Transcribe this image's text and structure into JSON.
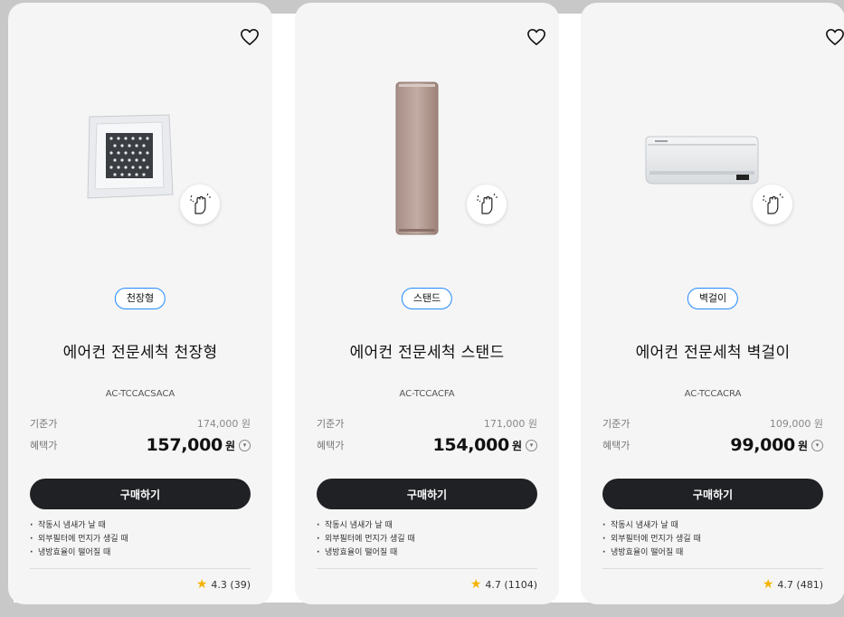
{
  "products": [
    {
      "tag": "천장형",
      "title": "에어컨 전문세척 천장형",
      "model": "AC-TCCACSACA",
      "base_label": "기준가",
      "base_price": "174,000 원",
      "benefit_label": "혜택가",
      "benefit_price": "157,000",
      "currency": "원",
      "buy_label": "구매하기",
      "notes": [
        "작동시 냄새가 날 때",
        "외부필터에 먼지가 생길 때",
        "냉방효율이 떨어질 때"
      ],
      "rating": "4.3 (39)"
    },
    {
      "tag": "스탠드",
      "title": "에어컨 전문세척 스탠드",
      "model": "AC-TCCACFA",
      "base_label": "기준가",
      "base_price": "171,000 원",
      "benefit_label": "혜택가",
      "benefit_price": "154,000",
      "currency": "원",
      "buy_label": "구매하기",
      "notes": [
        "작동시 냄새가 날 때",
        "외부필터에 먼지가 생길 때",
        "냉방효율이 떨어질 때"
      ],
      "rating": "4.7 (1104)"
    },
    {
      "tag": "벽걸이",
      "title": "에어컨 전문세척 벽걸이",
      "model": "AC-TCCACRA",
      "base_label": "기준가",
      "base_price": "109,000 원",
      "benefit_label": "혜택가",
      "benefit_price": "99,000",
      "currency": "원",
      "buy_label": "구매하기",
      "notes": [
        "작동시 냄새가 날 때",
        "외부필터에 먼지가 생길 때",
        "냉방효율이 떨어질 때"
      ],
      "rating": "4.7 (481)"
    }
  ],
  "colors": {
    "accent_border": "#2189ff",
    "button_bg": "#1f2124",
    "star": "#f5b301"
  },
  "icons": {
    "wishlist": "heart-outline-icon",
    "clean": "cleaning-hand-icon",
    "info": "chevron-down-circle-icon",
    "rating": "star-icon"
  }
}
